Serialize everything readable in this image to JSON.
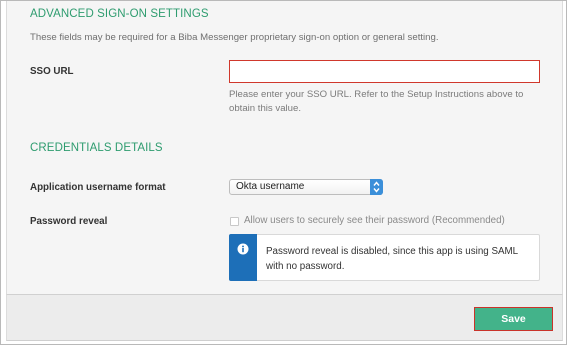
{
  "advanced": {
    "title": "ADVANCED SIGN-ON SETTINGS",
    "description": "These fields may be required for a Biba Messenger proprietary sign-on option or general setting.",
    "sso_label": "SSO URL",
    "sso_value": "",
    "sso_help": "Please enter your SSO URL. Refer to the Setup Instructions above to obtain this value."
  },
  "credentials": {
    "title": "CREDENTIALS DETAILS",
    "username_format_label": "Application username format",
    "username_format_value": "Okta username",
    "password_reveal_label": "Password reveal",
    "password_reveal_checkbox_label": "Allow users to securely see their password (Recommended)",
    "password_reveal_checked": false,
    "info_message": "Password reveal is disabled, since this app is using SAML with no password.",
    "info_icon": "info-icon"
  },
  "footer": {
    "save_label": "Save"
  },
  "colors": {
    "section_title": "#2e9c6f",
    "error_border": "#d0382c",
    "info_stripe": "#1d6fb8",
    "save_button": "#43b38a",
    "select_arrow": "#3b8fd9"
  }
}
